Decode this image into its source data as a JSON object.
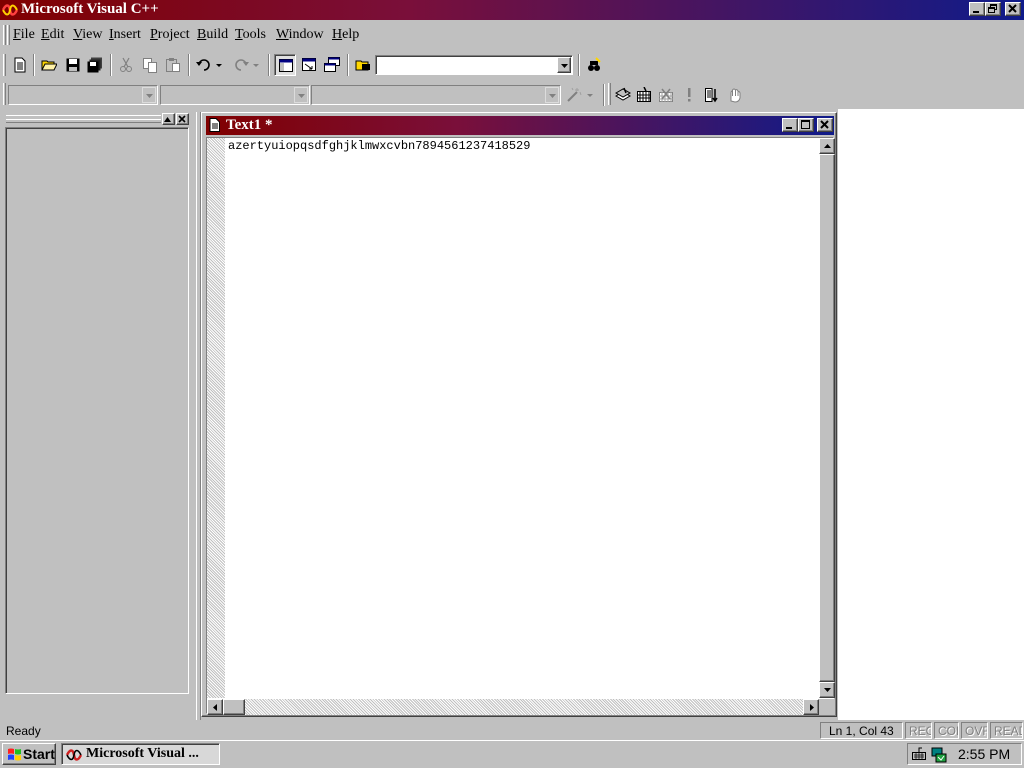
{
  "app": {
    "title": "Microsoft Visual C++"
  },
  "menu": {
    "items": [
      "File",
      "Edit",
      "View",
      "Insert",
      "Project",
      "Build",
      "Tools",
      "Window",
      "Help"
    ]
  },
  "toolbar": {
    "standard_icons": [
      "new-text-file-icon",
      "open-icon",
      "save-icon",
      "save-all-icon",
      "cut-icon",
      "copy-icon",
      "paste-icon",
      "undo-icon",
      "redo-icon",
      "workspace-icon",
      "output-icon",
      "window-list-icon",
      "find-in-files-icon",
      "search-icon"
    ],
    "find_combo_value": "",
    "build_icons": [
      "compile-icon",
      "build-icon",
      "stop-build-icon",
      "execute-icon",
      "go-icon",
      "breakpoint-icon"
    ],
    "class_combo_value": "",
    "filter_combo_value": "",
    "members_combo_value": ""
  },
  "document": {
    "title": "Text1 *",
    "lines": [
      "azertyuiopqsdfghjklmwxcvbn7894561237418529"
    ]
  },
  "status": {
    "message": "Ready",
    "position": "Ln 1, Col 43",
    "indicators": [
      "REC",
      "COL",
      "OVR",
      "READ"
    ]
  },
  "taskbar": {
    "start_label": "Start",
    "task_label": "Microsoft Visual ...",
    "clock": "2:55 PM"
  },
  "colors": {
    "active_caption_start": "#800000",
    "active_caption_end": "#0f1b8a",
    "face": "#c0c0c0"
  }
}
